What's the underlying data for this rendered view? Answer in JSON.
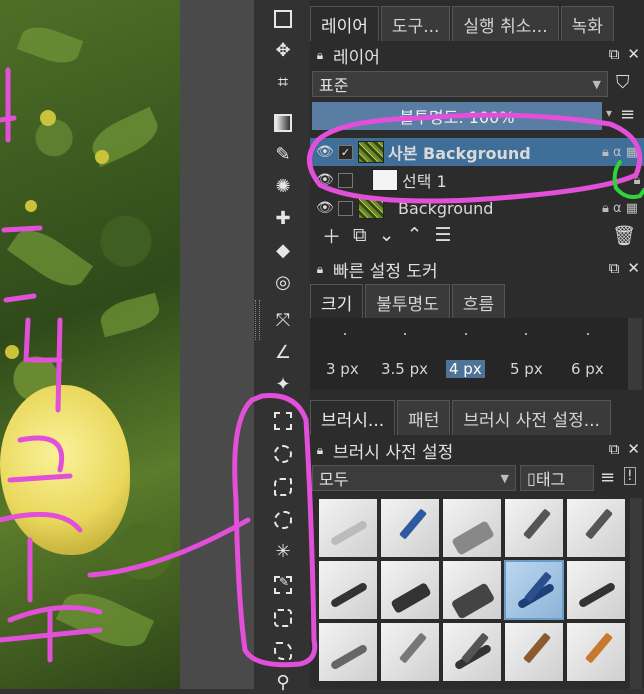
{
  "panels": {
    "top_tabs": [
      "레이어",
      "도구...",
      "실행 취소...",
      "녹화"
    ],
    "layers": {
      "title": "레이어",
      "blend_mode": "표준",
      "opacity": "불투명도:  100%",
      "rows": [
        {
          "name": "사본 Background",
          "selected": true,
          "checked": true
        },
        {
          "name": "선택 1",
          "selected": false,
          "checked": false
        },
        {
          "name": "Background",
          "selected": false,
          "checked": false
        }
      ]
    },
    "quick_settings": {
      "title": "빠른 설정 도커",
      "tabs": [
        "크기",
        "불투명도",
        "흐름"
      ],
      "sizes": [
        "3 px",
        "3.5 px",
        "4 px",
        "5 px",
        "6 px"
      ],
      "active_size": "4 px"
    },
    "brush_tabs": [
      "브러시...",
      "패턴",
      "브러시 사전 설정..."
    ],
    "brush_presets": {
      "title": "브러시 사전 설정",
      "filter": "모두",
      "tag": "태그"
    }
  },
  "colors": {
    "annotation_pink": "#e24fd8",
    "annotation_green": "#2fd33a",
    "selection_blue": "#3f6e99"
  },
  "icons": [
    "crop-icon",
    "move-icon",
    "gradient-icon",
    "eyedropper-icon",
    "fill-icon",
    "rect-select-icon",
    "ellipse-select-icon",
    "polygon-select-icon",
    "freehand-select-icon",
    "magic-wand-icon",
    "similar-select-icon",
    "bezier-select-icon",
    "magnetic-select-icon",
    "zoom-icon"
  ]
}
